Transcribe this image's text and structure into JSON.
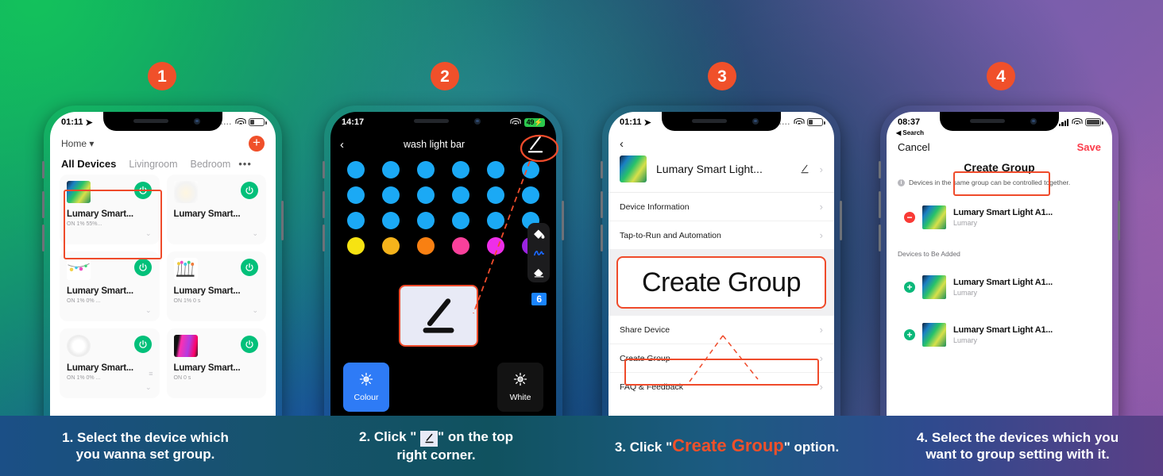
{
  "badges": [
    "1",
    "2",
    "3",
    "4"
  ],
  "phone1": {
    "status": {
      "time": "01:11",
      "location_icon": "location-arrow-icon",
      "signal": "....",
      "wifi": "wifi-icon",
      "battery": "battery-icon"
    },
    "home_label": "Home",
    "add_button": "+",
    "tabs": [
      {
        "label": "All Devices",
        "active": true
      },
      {
        "label": "Livingroom",
        "active": false
      },
      {
        "label": "Bedroom",
        "active": false
      }
    ],
    "tabs_more": "•••",
    "devices": [
      {
        "name": "Lumary Smart...",
        "meta": "ON   1%   55%...",
        "thumb": "light-strip",
        "power": "on",
        "selected": true
      },
      {
        "name": "Lumary Smart...",
        "meta": "",
        "thumb": "ceiling-light",
        "power": "on",
        "selected": false
      },
      {
        "name": "Lumary Smart...",
        "meta": "ON   1%   0%  ...",
        "thumb": "string-lights",
        "power": "on",
        "selected": false
      },
      {
        "name": "Lumary Smart...",
        "meta": "ON   1%   0 s",
        "thumb": "bulb-cluster",
        "power": "on",
        "selected": false
      },
      {
        "name": "Lumary Smart...",
        "meta": "ON   1%   0%  ...",
        "thumb": "downlight",
        "power": "on",
        "selected": false
      },
      {
        "name": "Lumary Smart...",
        "meta": "ON   0 s",
        "thumb": "light-panel",
        "power": "on",
        "selected": false
      }
    ]
  },
  "phone2": {
    "status": {
      "time": "14:17",
      "wifi": "wifi-icon",
      "battery_pct": "49"
    },
    "nav": {
      "back": "‹",
      "title": "wash light bar",
      "edit_icon": "pencil-underline-icon"
    },
    "dot_colors": [
      "#1ba9f5",
      "#1ba9f5",
      "#1ba9f5",
      "#1ba9f5",
      "#1ba9f5",
      "#1ba9f5",
      "#1ba9f5",
      "#1ba9f5",
      "#1ba9f5",
      "#1ba9f5",
      "#1ba9f5",
      "#1ba9f5",
      "#1ba9f5",
      "#1ba9f5",
      "#1ba9f5",
      "#1ba9f5",
      "#1ba9f5",
      "#1ba9f5",
      "#f6e312",
      "#f5b31b",
      "#f98012",
      "#f9409b",
      "#ee2ee9",
      "#9b23e0"
    ],
    "tools": [
      "paint-bucket-icon",
      "brush-icon",
      "eraser-icon"
    ],
    "count_badge": "6",
    "popup_icon": "pencil-underline-icon",
    "modes": [
      {
        "label": "Colour",
        "active": true,
        "icon": "brightness-icon"
      },
      {
        "label": "White",
        "active": false,
        "icon": "brightness-icon"
      }
    ]
  },
  "phone3": {
    "status": {
      "time": "01:11",
      "location_icon": "location-arrow-icon",
      "signal": "....",
      "wifi": "wifi-icon",
      "battery": "battery-icon"
    },
    "back": "‹",
    "device_title": "Lumary Smart Light...",
    "device_edit_icon": "pencil-underline-icon",
    "rows": [
      {
        "label": "Device Information"
      },
      {
        "label": "Tap-to-Run and Automation"
      }
    ],
    "zoom_card_label": "Create Group",
    "rows_after": [
      {
        "label": "Share Device",
        "highlighted": false
      },
      {
        "label": "Create Group",
        "highlighted": true
      },
      {
        "label": "FAQ & Feedback",
        "highlighted": false
      }
    ]
  },
  "phone4": {
    "status": {
      "time": "08:37",
      "back_to": "Search",
      "signal": "cell-bars-icon",
      "wifi": "wifi-icon",
      "battery": "battery-icon"
    },
    "cancel_label": "Cancel",
    "save_label": "Save",
    "title": "Create Group",
    "hint": "Devices in the same group can be controlled together.",
    "current_devices": [
      {
        "name": "Lumary Smart Light A1...",
        "brand": "Lumary",
        "action": "minus"
      }
    ],
    "section_label": "Devices to Be Added",
    "available_devices": [
      {
        "name": "Lumary Smart Light A1...",
        "brand": "Lumary",
        "action": "plus"
      },
      {
        "name": "Lumary Smart Light A1...",
        "brand": "Lumary",
        "action": "plus"
      }
    ]
  },
  "captions": [
    {
      "pre": "1. Select the device which",
      "post": "you wanna set group."
    },
    {
      "pre": "2. Click \" ",
      "mid_icon": "pencil-underline-icon",
      "post": " \" on the top right corner."
    },
    {
      "pre": "3. Click \"",
      "accent": "Create Group",
      "post": "\" option."
    },
    {
      "pre": "4. Select the devices which you",
      "post": "want to group setting with it."
    }
  ],
  "colors": {
    "accent": "#f0502a",
    "green": "#02c07a",
    "blue": "#1ba9f5",
    "save_red": "#fb3b4a"
  }
}
